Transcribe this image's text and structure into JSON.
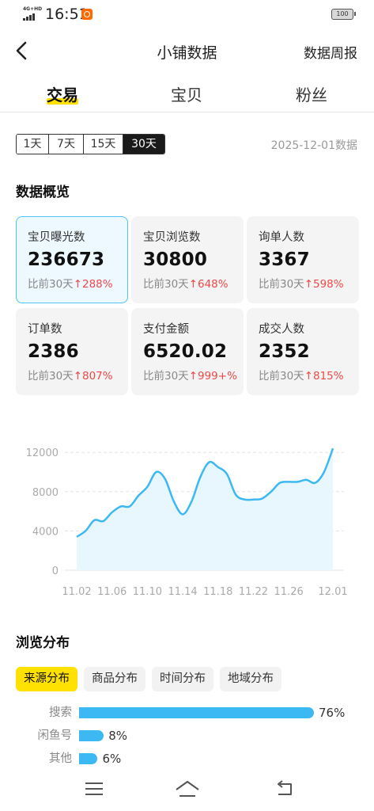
{
  "status_bar": {
    "network": "4G+HD",
    "time": "16:51",
    "battery": "100"
  },
  "nav": {
    "title": "小铺数据",
    "right_action": "数据周报"
  },
  "top_tabs": [
    {
      "label": "交易",
      "active": true
    },
    {
      "label": "宝贝",
      "active": false
    },
    {
      "label": "粉丝",
      "active": false
    }
  ],
  "period": {
    "options": [
      {
        "label": "1天",
        "active": false
      },
      {
        "label": "7天",
        "active": false
      },
      {
        "label": "15天",
        "active": false
      },
      {
        "label": "30天",
        "active": true
      }
    ],
    "date_text": "2025-12-01数据"
  },
  "overview": {
    "title": "数据概览",
    "metrics": [
      {
        "label": "宝贝曝光数",
        "value": "236673",
        "compare": "比前30天",
        "change": "↑288%",
        "selected": true
      },
      {
        "label": "宝贝浏览数",
        "value": "30800",
        "compare": "比前30天",
        "change": "↑648%",
        "selected": false
      },
      {
        "label": "询单人数",
        "value": "3367",
        "compare": "比前30天",
        "change": "↑598%",
        "selected": false
      },
      {
        "label": "订单数",
        "value": "2386",
        "compare": "比前30天",
        "change": "↑807%",
        "selected": false
      },
      {
        "label": "支付金额",
        "value": "6520.02",
        "compare": "比前30天",
        "change": "↑999+%",
        "selected": false
      },
      {
        "label": "成交人数",
        "value": "2352",
        "compare": "比前30天",
        "change": "↑815%",
        "selected": false
      }
    ]
  },
  "chart_data": {
    "type": "area",
    "x": [
      "11.02",
      "11.03",
      "11.04",
      "11.05",
      "11.06",
      "11.07",
      "11.08",
      "11.09",
      "11.10",
      "11.11",
      "11.12",
      "11.13",
      "11.14",
      "11.15",
      "11.16",
      "11.17",
      "11.18",
      "11.19",
      "11.20",
      "11.21",
      "11.22",
      "11.23",
      "11.24",
      "11.25",
      "11.26",
      "11.27",
      "11.28",
      "11.29",
      "11.30",
      "12.01"
    ],
    "values": [
      3400,
      4000,
      5100,
      5000,
      5900,
      6500,
      6500,
      7600,
      8500,
      10000,
      9300,
      7000,
      5700,
      7000,
      9500,
      11000,
      10500,
      9800,
      7700,
      7200,
      7200,
      7300,
      8000,
      8900,
      9000,
      9000,
      9200,
      8900,
      10000,
      12400
    ],
    "x_tick_labels": [
      "11.02",
      "11.06",
      "11.10",
      "11.14",
      "11.18",
      "11.22",
      "11.26",
      "12.01"
    ],
    "y_ticks": [
      0,
      4000,
      8000,
      12000
    ],
    "y_tick_labels": [
      "0",
      "4000",
      "8000",
      "12000"
    ],
    "ylim": [
      0,
      12500
    ],
    "grid": true,
    "line_color": "#3cb8f2",
    "fill_color": "#e8f6fe",
    "title": "",
    "xlabel": "",
    "ylabel": ""
  },
  "distribution": {
    "title": "浏览分布",
    "tabs": [
      {
        "label": "来源分布",
        "active": true
      },
      {
        "label": "商品分布",
        "active": false
      },
      {
        "label": "时间分布",
        "active": false
      },
      {
        "label": "地域分布",
        "active": false
      }
    ],
    "rows": [
      {
        "label": "搜索",
        "percent": 76,
        "value_text": "76%"
      },
      {
        "label": "闲鱼号",
        "percent": 8,
        "value_text": "8%"
      },
      {
        "label": "其他",
        "percent": 6,
        "value_text": "6%"
      }
    ],
    "bar_color": "#3cb8f2"
  },
  "bottom_nav": {
    "icons": [
      "menu-icon",
      "home-icon",
      "back-icon"
    ]
  }
}
